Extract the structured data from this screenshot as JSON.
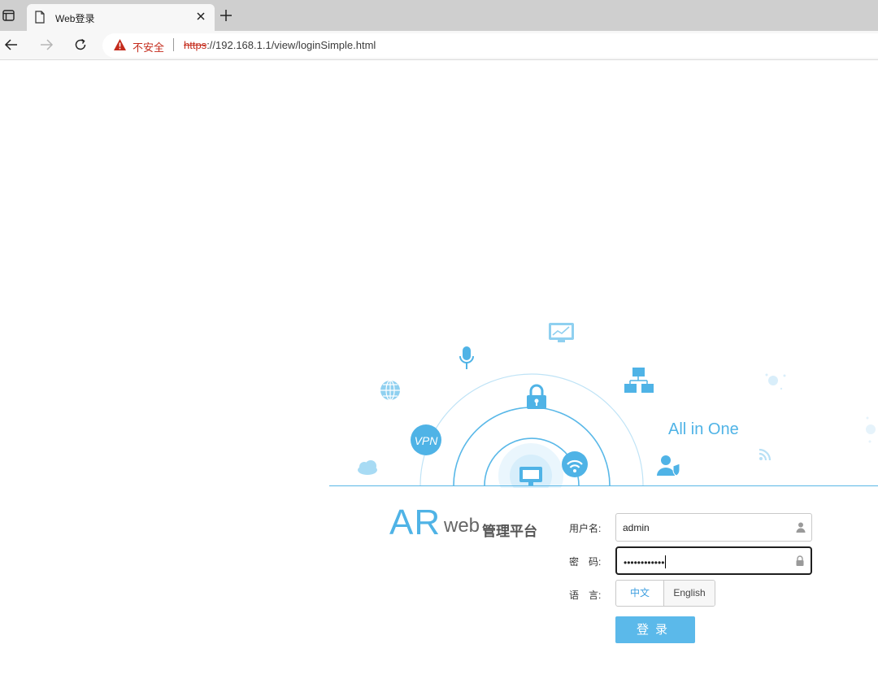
{
  "browser": {
    "tab_title": "Web登录",
    "security_label": "不安全",
    "url_protocol": "https",
    "url_rest": "://192.168.1.1/view/loginSimple.html"
  },
  "hero": {
    "tagline": "All in One",
    "vpn_label": "VPN"
  },
  "brand": {
    "ar": "AR",
    "web": "web",
    "platform": "管理平台"
  },
  "login": {
    "username_label": "用户名:",
    "username_value": "admin",
    "password_label": "密　码:",
    "password_mask": "••••••••••••",
    "language_label": "语　言:",
    "lang_zh": "中文",
    "lang_en": "English",
    "submit_label": "登录"
  },
  "colors": {
    "accent": "#5bb9ea",
    "brand_blue": "#4fb3e6",
    "warning_red": "#c42b1c"
  }
}
